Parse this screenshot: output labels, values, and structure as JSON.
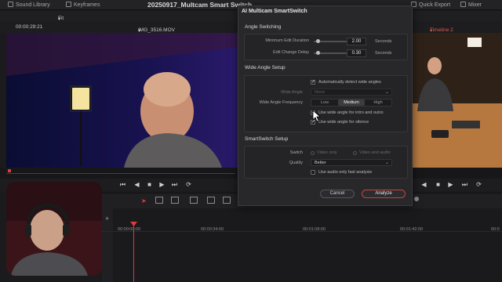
{
  "topbar": {
    "sound_library": "Sound Library",
    "keyframes": "Keyframes",
    "project_title": "20250917_Multcam Smart Switch",
    "quick_export": "Quick Export",
    "mixer": "Mixer"
  },
  "source_viewer": {
    "fit_label": "Fit",
    "timecode": "00:00:29:21",
    "clip_name": "IMG_3516.MOV"
  },
  "timeline_viewer": {
    "timeline_name": "Timeline 2"
  },
  "dialog": {
    "title": "AI Multicam SmartSwitch",
    "angle_switching": {
      "heading": "Angle Switching",
      "min_edit_label": "Minimum Edit Duration",
      "min_edit_value": "2.00",
      "min_edit_unit": "Seconds",
      "min_edit_fraction": 0.1,
      "delay_label": "Edit Change Delay",
      "delay_value": "0.30",
      "delay_unit": "Seconds",
      "delay_fraction": 0.1
    },
    "wide_angle": {
      "heading": "Wide Angle Setup",
      "auto_detect_label": "Automatically detect wide angles",
      "auto_detect_checked": true,
      "wide_angle_label": "Wide Angle",
      "wide_angle_value": "None",
      "frequency_label": "Wide Angle Frequency",
      "frequency_options": [
        "Low",
        "Medium",
        "High"
      ],
      "frequency_selected": "Medium",
      "intro_outro_label": "Use wide angle for intro and outro",
      "intro_outro_checked": true,
      "silence_label": "Use wide angle for silence",
      "silence_checked": true
    },
    "smartswitch": {
      "heading": "SmartSwitch Setup",
      "switch_label": "Switch",
      "switch_option_1": "Video only",
      "switch_option_2": "Video and audio",
      "quality_label": "Quality",
      "quality_value": "Better",
      "audio_only_label": "Use audio only fast analysis",
      "audio_only_checked": false
    },
    "cancel_label": "Cancel",
    "analyze_label": "Analyze"
  },
  "timeline": {
    "ruler": [
      "00:00:00:00",
      "00:00:34:00",
      "00:01:08:00",
      "00:01:42:00",
      "00:0"
    ]
  },
  "colors": {
    "accent_red": "#e03a3a",
    "dialog_bg": "#28282b",
    "analyze_border": "#c6433d"
  }
}
